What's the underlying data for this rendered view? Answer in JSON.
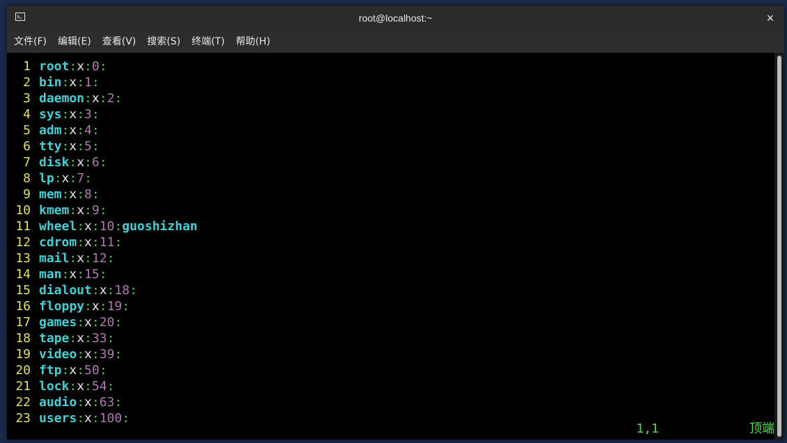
{
  "window": {
    "title": "root@localhost:~",
    "close_label": "×"
  },
  "menu": [
    {
      "label": "文件(F)"
    },
    {
      "label": "编辑(E)"
    },
    {
      "label": "查看(V)"
    },
    {
      "label": "搜索(S)"
    },
    {
      "label": "终端(T)"
    },
    {
      "label": "帮助(H)"
    }
  ],
  "lines": [
    {
      "n": "1",
      "name": "root",
      "x": "x",
      "gid": "0",
      "members": ""
    },
    {
      "n": "2",
      "name": "bin",
      "x": "x",
      "gid": "1",
      "members": ""
    },
    {
      "n": "3",
      "name": "daemon",
      "x": "x",
      "gid": "2",
      "members": ""
    },
    {
      "n": "4",
      "name": "sys",
      "x": "x",
      "gid": "3",
      "members": ""
    },
    {
      "n": "5",
      "name": "adm",
      "x": "x",
      "gid": "4",
      "members": ""
    },
    {
      "n": "6",
      "name": "tty",
      "x": "x",
      "gid": "5",
      "members": ""
    },
    {
      "n": "7",
      "name": "disk",
      "x": "x",
      "gid": "6",
      "members": ""
    },
    {
      "n": "8",
      "name": "lp",
      "x": "x",
      "gid": "7",
      "members": ""
    },
    {
      "n": "9",
      "name": "mem",
      "x": "x",
      "gid": "8",
      "members": ""
    },
    {
      "n": "10",
      "name": "kmem",
      "x": "x",
      "gid": "9",
      "members": ""
    },
    {
      "n": "11",
      "name": "wheel",
      "x": "x",
      "gid": "10",
      "members": "guoshizhan"
    },
    {
      "n": "12",
      "name": "cdrom",
      "x": "x",
      "gid": "11",
      "members": ""
    },
    {
      "n": "13",
      "name": "mail",
      "x": "x",
      "gid": "12",
      "members": ""
    },
    {
      "n": "14",
      "name": "man",
      "x": "x",
      "gid": "15",
      "members": ""
    },
    {
      "n": "15",
      "name": "dialout",
      "x": "x",
      "gid": "18",
      "members": ""
    },
    {
      "n": "16",
      "name": "floppy",
      "x": "x",
      "gid": "19",
      "members": ""
    },
    {
      "n": "17",
      "name": "games",
      "x": "x",
      "gid": "20",
      "members": ""
    },
    {
      "n": "18",
      "name": "tape",
      "x": "x",
      "gid": "33",
      "members": ""
    },
    {
      "n": "19",
      "name": "video",
      "x": "x",
      "gid": "39",
      "members": ""
    },
    {
      "n": "20",
      "name": "ftp",
      "x": "x",
      "gid": "50",
      "members": ""
    },
    {
      "n": "21",
      "name": "lock",
      "x": "x",
      "gid": "54",
      "members": ""
    },
    {
      "n": "22",
      "name": "audio",
      "x": "x",
      "gid": "63",
      "members": ""
    },
    {
      "n": "23",
      "name": "users",
      "x": "x",
      "gid": "100",
      "members": ""
    }
  ],
  "status": {
    "cursor": "1,1",
    "scroll": "顶端"
  },
  "colors": {
    "line_number": "#e5e34f",
    "name": "#3dd3d6",
    "colon": "#4ec94e",
    "gid": "#b178b3",
    "status": "#4ee04e"
  }
}
